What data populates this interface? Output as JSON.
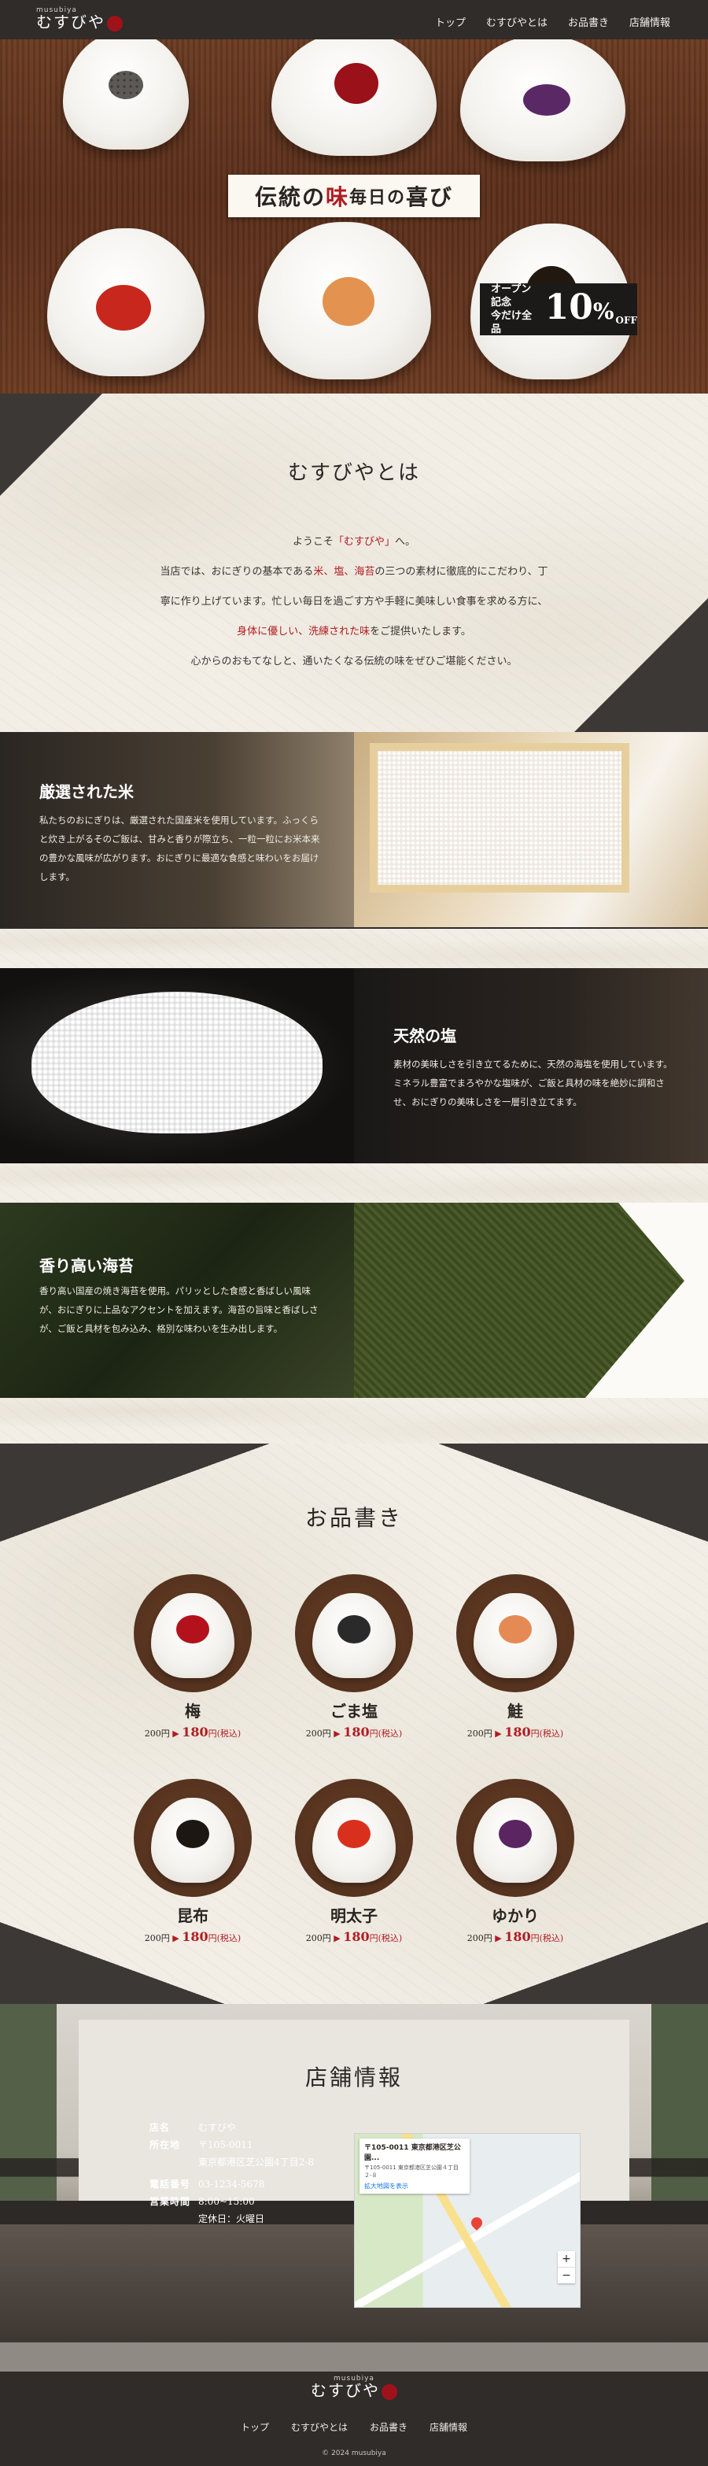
{
  "header": {
    "logo_sub": "musubiya",
    "logo_main": "むすびや",
    "nav": [
      "トップ",
      "むすびやとは",
      "お品書き",
      "店舗情報"
    ]
  },
  "hero": {
    "title_a": "伝統の",
    "title_red": "味",
    "title_b": " 毎日の",
    "title_c": "喜び",
    "badge_line1": "オープン記念",
    "badge_line2": "今だけ全品",
    "badge_num": "10",
    "badge_pct": "%",
    "badge_off": "OFF"
  },
  "about": {
    "title": "むすびやとは",
    "line1_a": "ようこそ",
    "line1_red": "「むすびや」",
    "line1_b": "へ。",
    "line2_a": "当店では、おにぎりの基本である",
    "line2_red": "米、塩、海苔",
    "line2_b": "の三つの素材に徹底的にこだわり、丁",
    "line3": "寧に作り上げています。忙しい毎日を過ごす方や手軽に美味しい食事を求める方に、",
    "line4_red1": "身体に優しい、洗練された味",
    "line4_b": "をご提供いたします。",
    "line5": "心からのおもてなしと、通いたくなる伝統の味をぜひご堪能ください。"
  },
  "features": [
    {
      "title": "厳選された米",
      "text": "私たちのおにぎりは、厳選された国産米を使用しています。ふっくらと炊き上がるそのご飯は、甘みと香りが際立ち、一粒一粒にお米本来の豊かな風味が広がります。おにぎりに最適な食感と味わいをお届けします。"
    },
    {
      "title": "天然の塩",
      "text": "素材の美味しさを引き立てるために、天然の海塩を使用しています。ミネラル豊富でまろやかな塩味が、ご飯と具材の味を絶妙に調和させ、おにぎりの美味しさを一層引き立てます。"
    },
    {
      "title": "香り高い海苔",
      "text": "香り高い国産の焼き海苔を使用。パリッとした食感と香ばしい風味が、おにぎりに上品なアクセントを加えます。海苔の旨味と香ばしさが、ご飯と具材を包み込み、格別な味わいを生み出します。"
    }
  ],
  "menu": {
    "title": "お品書き",
    "price_before": "200円",
    "arrow": "▶",
    "price_after": "180",
    "price_suffix": "円(税込)",
    "items": [
      {
        "name": "梅",
        "color": "#b3121c"
      },
      {
        "name": "ごま塩",
        "color": "#2a2a2a"
      },
      {
        "name": "鮭",
        "color": "#e58a55"
      },
      {
        "name": "昆布",
        "color": "#1d1712"
      },
      {
        "name": "明太子",
        "color": "#d9301e"
      },
      {
        "name": "ゆかり",
        "color": "#5a2560"
      }
    ]
  },
  "store": {
    "title": "店舗情報",
    "rows": [
      {
        "k": "店名",
        "v": "むすびや"
      },
      {
        "k": "所在地",
        "v": "〒105-0011"
      },
      {
        "k": "",
        "v": "東京都港区芝公園4丁目2-8"
      },
      {
        "k": "電話番号",
        "v": "03-1234-5678"
      },
      {
        "k": "営業時間",
        "v": "8:00~15:00"
      },
      {
        "k": "",
        "v": "定休日：火曜日"
      }
    ],
    "map_addr": "〒105-0011 東京都港区芝公園...",
    "map_addr_sub": "〒105-0011 東京都港区芝公園４丁目２-８",
    "map_link": "拡大地図を表示",
    "map_zoom_in": "+",
    "map_zoom_out": "−"
  },
  "footer": {
    "logo_sub": "musubiya",
    "logo_main": "むすびや",
    "nav": [
      "トップ",
      "むすびやとは",
      "お品書き",
      "店舗情報"
    ],
    "copyright": "© 2024 musubiya"
  }
}
